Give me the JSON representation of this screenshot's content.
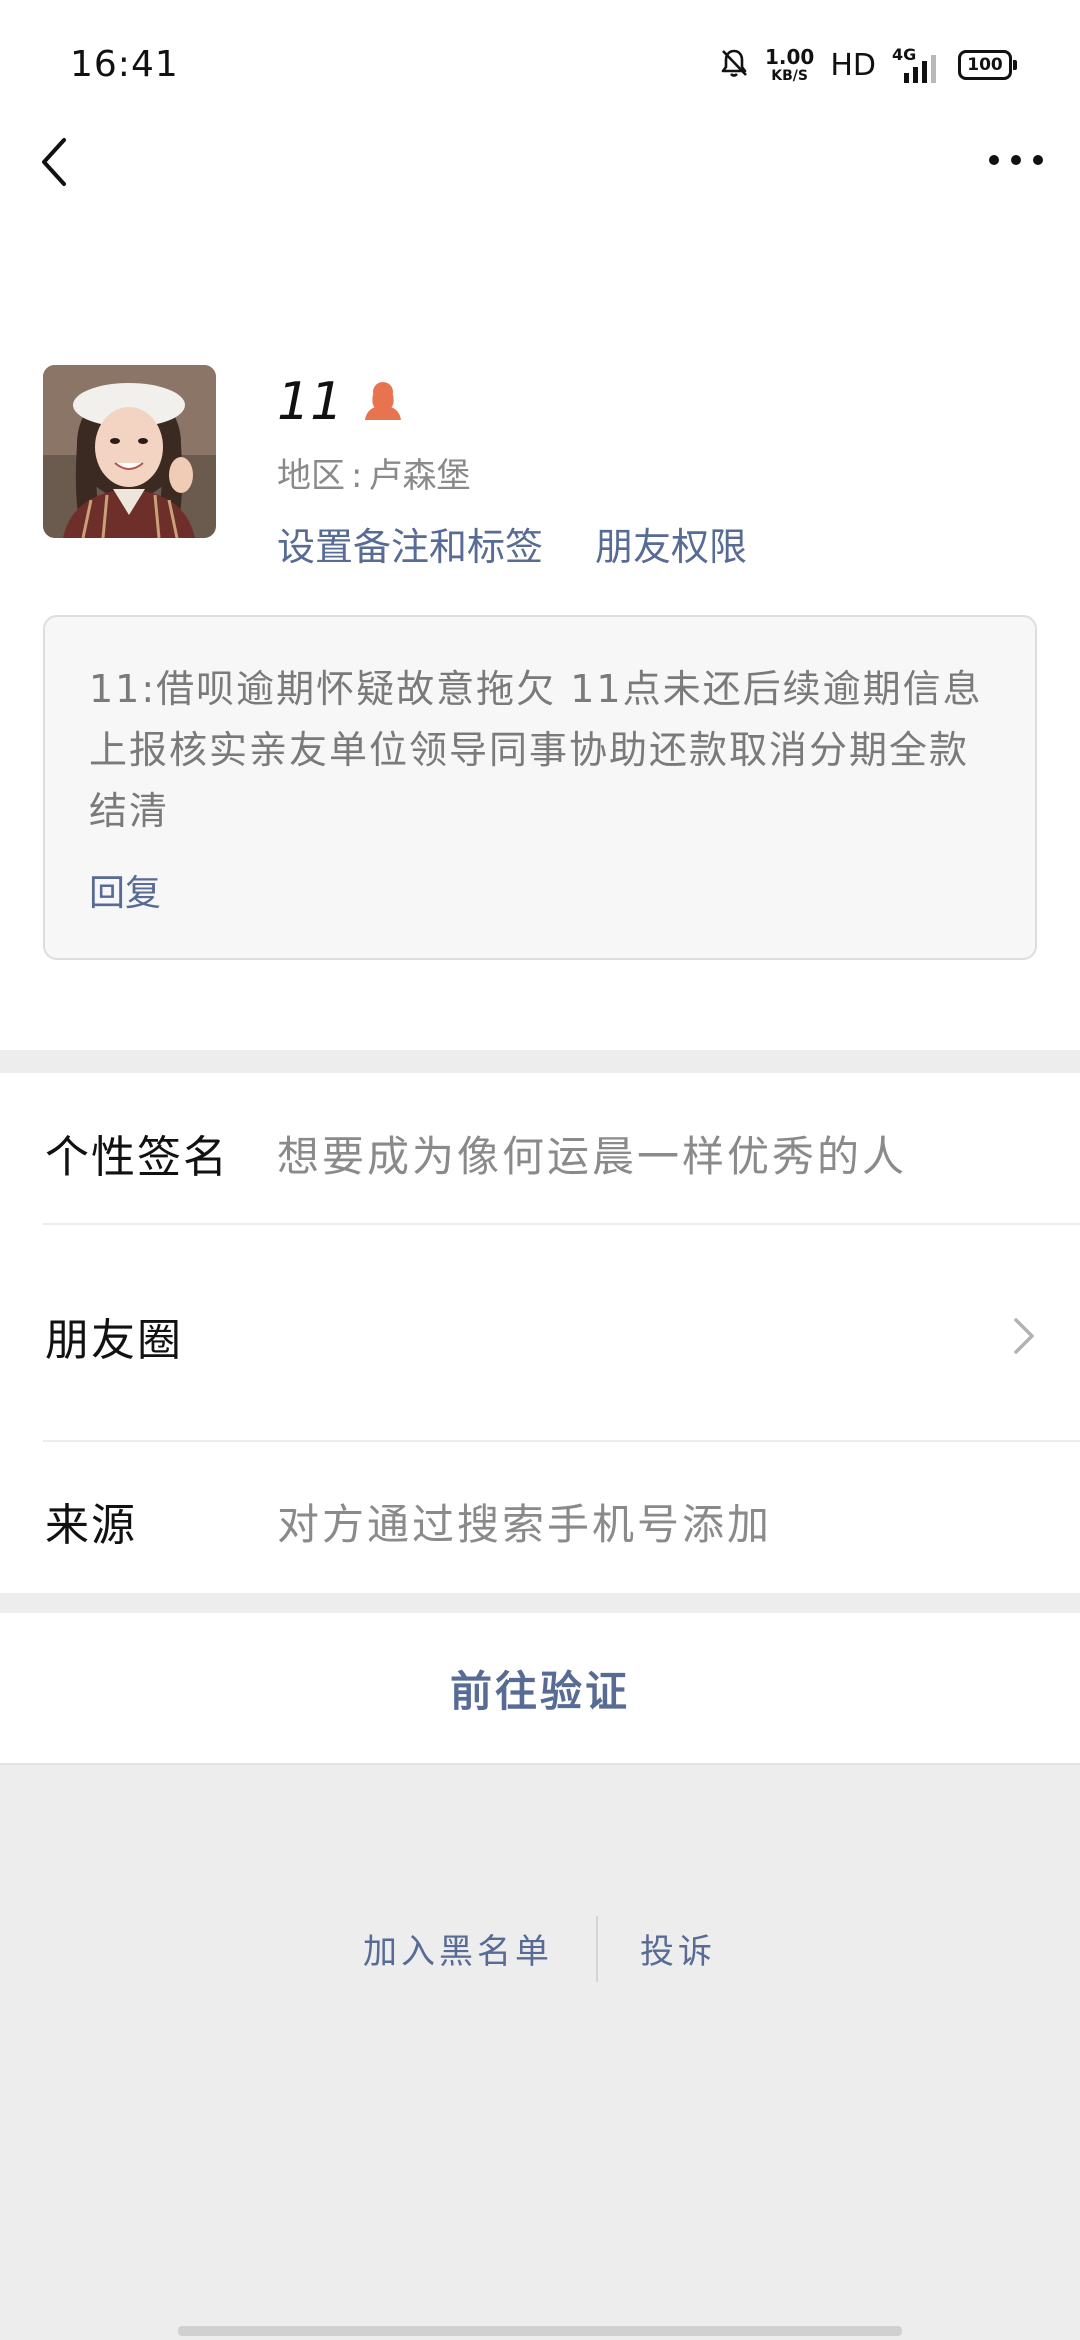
{
  "status_bar": {
    "time": "16:41",
    "speed_value": "1.00",
    "speed_unit": "KB/S",
    "hd": "HD",
    "network": "4G",
    "battery": "100"
  },
  "nav": {
    "back_icon": "chevron-left-icon",
    "more_icon": "more-dots-icon"
  },
  "profile": {
    "name": "11",
    "gender_icon": "female-user-icon",
    "gender_icon_color": "#e8734f",
    "region_label": "地区",
    "region_sep": ":",
    "region_value": "卢森堡",
    "set_remark_label": "设置备注和标签",
    "friend_permission_label": "朋友权限"
  },
  "message": {
    "text": "11:借呗逾期怀疑故意拖欠 11点未还后续逾期信息上报核实亲友单位领导同事协助还款取消分期全款结清",
    "reply_label": "回复"
  },
  "info": {
    "signature_label": "个性签名",
    "signature_value": "想要成为像何运晨一样优秀的人",
    "moments_label": "朋友圈",
    "source_label": "来源",
    "source_value": "对方通过搜索手机号添加"
  },
  "actions": {
    "verify_label": "前往验证",
    "blacklist_label": "加入黑名单",
    "complain_label": "投诉"
  },
  "colors": {
    "link": "#576b95",
    "background": "#ededed",
    "card_bg": "#f7f7f7"
  }
}
